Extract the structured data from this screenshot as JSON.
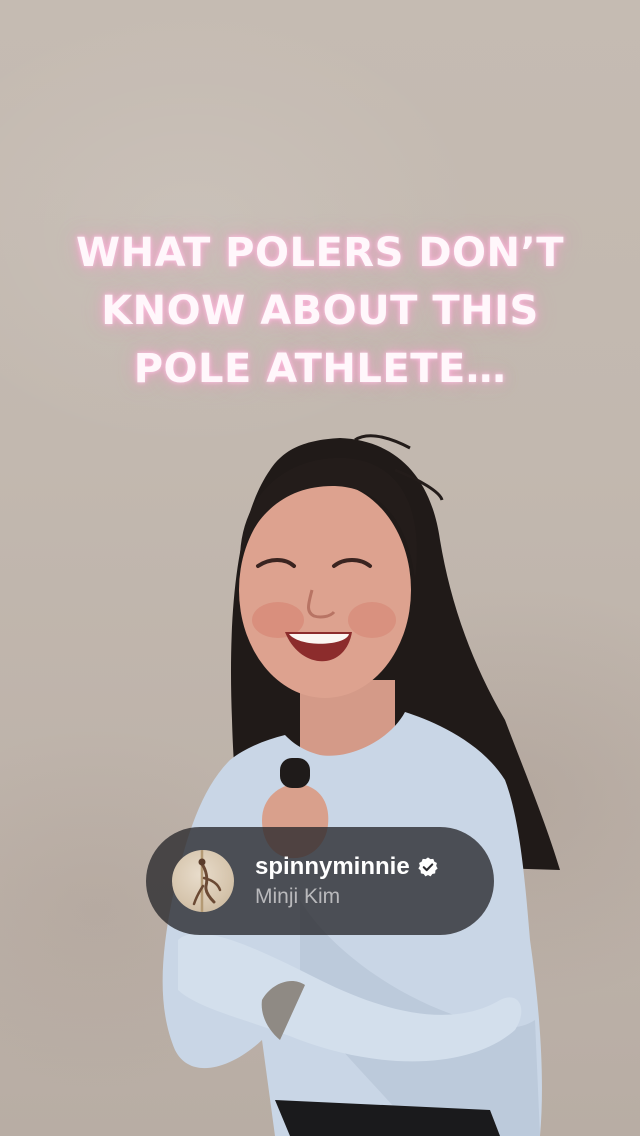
{
  "caption": {
    "text": "WHAT POLERS DON’T\nKNOW ABOUT THIS\nPOLE ATHLETE…"
  },
  "user_tag": {
    "username": "spinnyminnie",
    "display_name": "Minji Kim",
    "verified": true,
    "verified_icon": "verified-badge-icon",
    "avatar_icon": "pole-dancer-avatar"
  },
  "colors": {
    "wall": "#c2b8af",
    "neon_text": "#fff7fb",
    "neon_glow": "#ff9fd0",
    "shirt": "#c9d6e6",
    "tag_bg": "#28282c"
  }
}
